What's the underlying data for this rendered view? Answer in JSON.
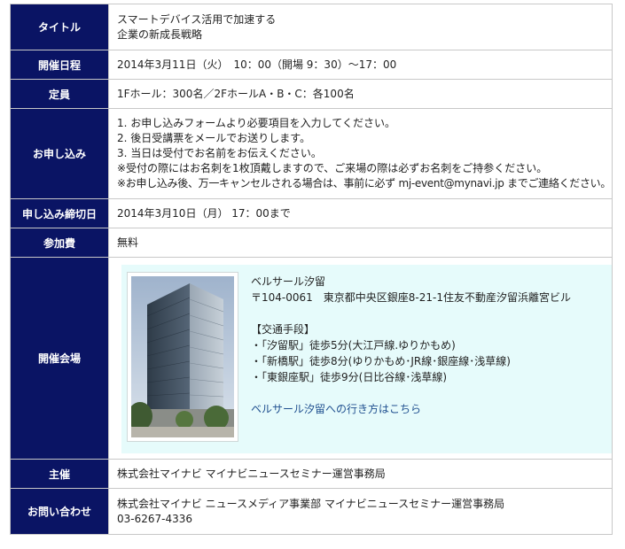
{
  "rows": {
    "title": {
      "label": "タイトル",
      "lines": [
        "スマートデバイス活用で加速する",
        "企業の新成長戦略"
      ]
    },
    "date": {
      "label": "開催日程",
      "value": "2014年3月11日（火）　10：00（開場 9：30）〜17：00"
    },
    "capacity": {
      "label": "定員",
      "value": "1Fホール：300名／2FホールA・B・C：各100名"
    },
    "apply": {
      "label": "お申し込み",
      "lines": [
        "1.  お申し込みフォームより必要項目を入力してください。",
        "2.  後日受講票をメールでお送りします。",
        "3.  当日は受付でお名前をお伝えください。",
        "※受付の際にはお名刺を1枚頂戴しますので、ご来場の際は必ずお名刺をご持参ください。",
        "※お申し込み後、万一キャンセルされる場合は、事前に必ず mj-event@mynavi.jp までご連絡ください。"
      ]
    },
    "deadline": {
      "label": "申し込み締切日",
      "value": "2014年3月10日（月） 17：00まで"
    },
    "fee": {
      "label": "参加費",
      "value": "無料"
    },
    "venue": {
      "label": "開催会場",
      "name": "ベルサール汐留",
      "address": "〒104-0061　東京都中央区銀座8-21-1住友不動産汐留浜離宮ビル",
      "access_heading": "【交通手段】",
      "access": [
        "・「汐留駅」徒歩5分(大江戸線.ゆりかもめ)",
        "・「新橋駅」徒歩8分(ゆりかもめ･JR線･銀座線･浅草線)",
        "・「東銀座駅」徒歩9分(日比谷線･浅草線)"
      ],
      "link": "ベルサール汐留への行き方はこちら"
    },
    "organizer": {
      "label": "主催",
      "value": "株式会社マイナビ マイナビニュースセミナー運営事務局"
    },
    "contact": {
      "label": "お問い合わせ",
      "lines": [
        "株式会社マイナビ ニュースメディア事業部 マイナビニュースセミナー運営事務局",
        "03-6267-4336"
      ]
    }
  },
  "colors": {
    "header_bg": "#0a1464",
    "venue_bg": "#e6fbfb",
    "link": "#1f4f8f"
  }
}
